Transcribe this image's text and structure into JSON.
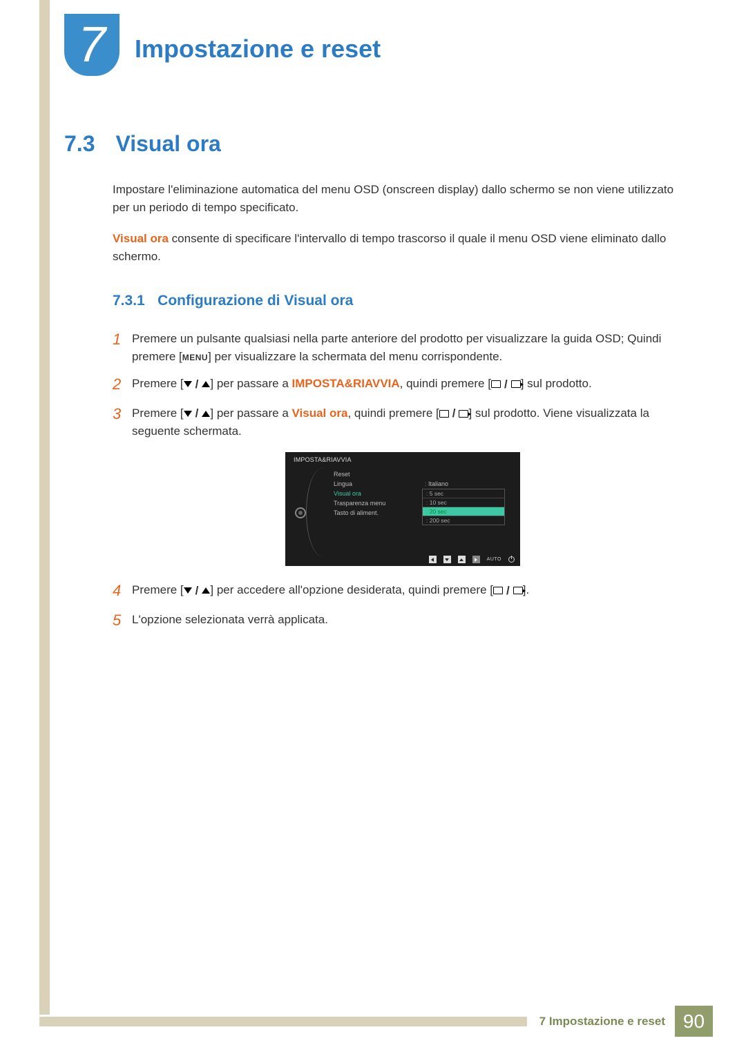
{
  "chapter": {
    "number": "7",
    "title": "Impostazione e reset"
  },
  "section": {
    "number": "7.3",
    "title": "Visual ora"
  },
  "intro1": "Impostare l'eliminazione automatica del menu OSD (onscreen display) dallo schermo se non viene utilizzato per un periodo di tempo specificato.",
  "intro2_bold": "Visual ora",
  "intro2_rest": " consente di specificare l'intervallo di tempo trascorso il quale il menu OSD viene eliminato dallo schermo.",
  "subsection": {
    "number": "7.3.1",
    "title": "Configurazione di Visual ora"
  },
  "steps": {
    "s1": {
      "num": "1",
      "a": "Premere un pulsante qualsiasi nella parte anteriore del prodotto per visualizzare la guida OSD; Quindi premere [",
      "menu": "MENU",
      "b": "] per visualizzare la schermata del menu corrispondente."
    },
    "s2": {
      "num": "2",
      "a": "Premere [",
      "b": "] per passare a ",
      "target": "IMPOSTA&RIAVVIA",
      "c": ", quindi premere [",
      "d": "] sul prodotto."
    },
    "s3": {
      "num": "3",
      "a": "Premere [",
      "b": "] per passare a ",
      "target": "Visual ora",
      "c": ", quindi premere [",
      "d": "] sul prodotto. Viene visualizzata la seguente schermata."
    },
    "s4": {
      "num": "4",
      "a": "Premere [",
      "b": "] per accedere all'opzione desiderata, quindi premere [",
      "c": "]."
    },
    "s5": {
      "num": "5",
      "text": "L'opzione selezionata verrà applicata."
    }
  },
  "osd": {
    "title": "IMPOSTA&RIAVVIA",
    "items": [
      {
        "label": "Reset",
        "value": ""
      },
      {
        "label": "Lingua",
        "value": "Italiano"
      },
      {
        "label": "Visual ora",
        "active": true
      },
      {
        "label": "Trasparenza menu",
        "value": ""
      },
      {
        "label": "Tasto di aliment.",
        "value": ""
      }
    ],
    "options": [
      "5 sec",
      "10 sec",
      "20 sec",
      "200 sec"
    ],
    "selected_option": "20 sec",
    "auto": "AUTO"
  },
  "footer": {
    "label": "7 Impostazione e reset",
    "page": "90"
  }
}
